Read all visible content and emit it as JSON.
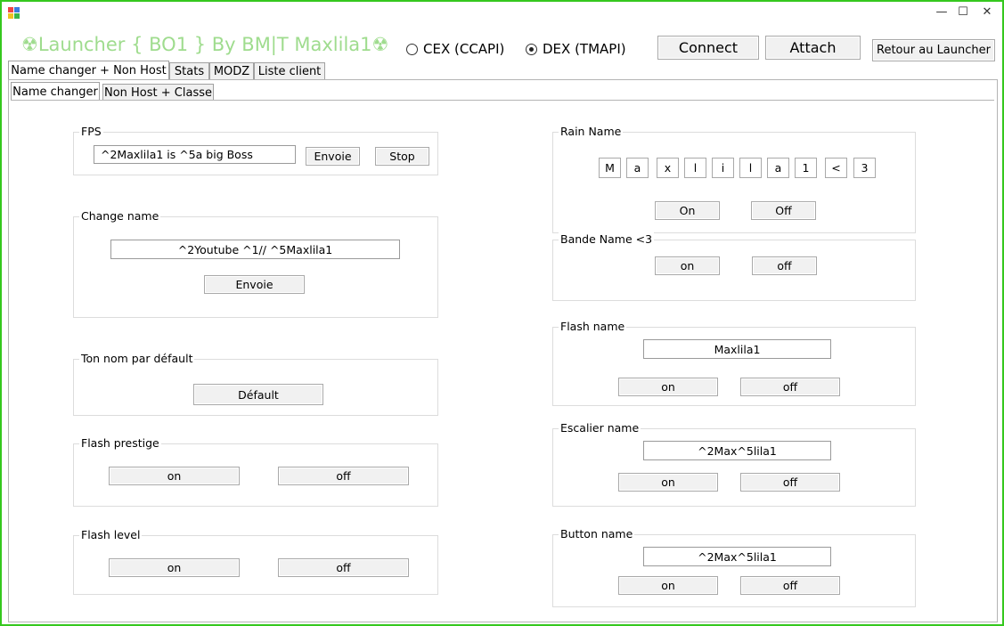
{
  "window": {
    "title": "☢Launcher { BO1 }  By BM|T Maxlila1☢",
    "controls": {
      "minimize": "—",
      "maximize": "☐",
      "close": "✕"
    }
  },
  "connection": {
    "cex_label": "CEX (CCAPI)",
    "dex_label": "DEX (TMAPI)",
    "selected": "DEX (TMAPI)",
    "connect_label": "Connect",
    "attach_label": "Attach",
    "retour_label": "Retour au Launcher"
  },
  "tabs": [
    {
      "label": "Name changer + Non Host",
      "active": true
    },
    {
      "label": "Stats",
      "active": false
    },
    {
      "label": "MODZ",
      "active": false
    },
    {
      "label": "Liste client",
      "active": false
    }
  ],
  "subtabs": [
    {
      "label": "Name changer",
      "active": true
    },
    {
      "label": "Non Host + Classe",
      "active": false
    }
  ],
  "fps": {
    "label": "FPS",
    "value": "^2Maxlila1 is ^5a big Boss",
    "send_label": "Envoie",
    "stop_label": "Stop"
  },
  "change_name": {
    "label": "Change name",
    "value": "^2Youtube ^1// ^5Maxlila1",
    "send_label": "Envoie"
  },
  "default_name": {
    "label": "Ton nom par défault",
    "button_label": "Défault"
  },
  "flash_prestige": {
    "label": "Flash prestige",
    "on_label": "on",
    "off_label": "off"
  },
  "flash_level": {
    "label": "Flash level",
    "on_label": "on",
    "off_label": "off"
  },
  "rain_name": {
    "label": "Rain Name",
    "letters": [
      "M",
      "a",
      "x",
      "l",
      "i",
      "l",
      "a",
      "1",
      "<",
      "3"
    ],
    "on_label": "On",
    "off_label": "Off"
  },
  "bande_name": {
    "label": "Bande Name <3",
    "on_label": "on",
    "off_label": "off"
  },
  "flash_name": {
    "label": "Flash name",
    "value": "Maxlila1",
    "on_label": "on",
    "off_label": "off"
  },
  "escalier_name": {
    "label": "Escalier name",
    "value": "^2Max^5lila1",
    "on_label": "on",
    "off_label": "off"
  },
  "button_name": {
    "label": "Button name",
    "value": "^2Max^5lila1",
    "on_label": "on",
    "off_label": "off"
  },
  "colors": {
    "frame_border": "#35c81e",
    "title_text": "#9fdc8e",
    "button_face": "#f1f1f1"
  }
}
